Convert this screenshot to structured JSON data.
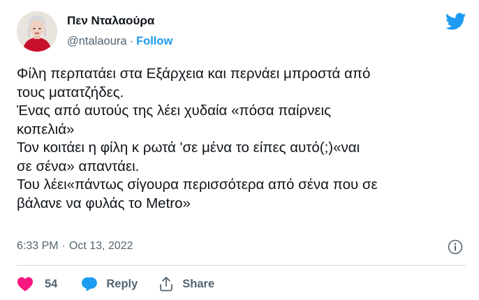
{
  "author": {
    "display_name": "Πεν Νταλαούρα",
    "handle": "@ntalaoura",
    "separator": "·",
    "follow_label": "Follow"
  },
  "tweet": {
    "lines": [
      "Φίλη περπατάει στα Εξάρχεια και περνάει μπροστά από",
      "τους ματατζήδες.",
      "Ένας από αυτούς της λέει χυδαία «πόσα παίρνεις",
      "κοπελιά»",
      "Τον κοιτάει η φίλη κ ρωτά 'σε μένα το είπες αυτό(;)«ναι",
      "σε σένα» απαντάει.",
      "Του λέει«πάντως σίγουρα περισσότερα από σένα που σε",
      "βάλανε να φυλάς το Metro»"
    ],
    "time": "6:33 PM",
    "meta_separator": "·",
    "date": "Oct 13, 2022"
  },
  "actions": {
    "like_count": "54",
    "reply_label": "Reply",
    "share_label": "Share"
  },
  "icons": {
    "brand": "twitter-bird-icon",
    "info": "info-icon",
    "like": "heart-icon",
    "reply": "speech-bubble-icon",
    "share": "share-upload-icon"
  },
  "colors": {
    "brand_blue": "#1d9bf0",
    "like_pink": "#f91880",
    "muted_text": "#536471",
    "main_text": "#0f1419",
    "divider": "#cfd9de"
  }
}
